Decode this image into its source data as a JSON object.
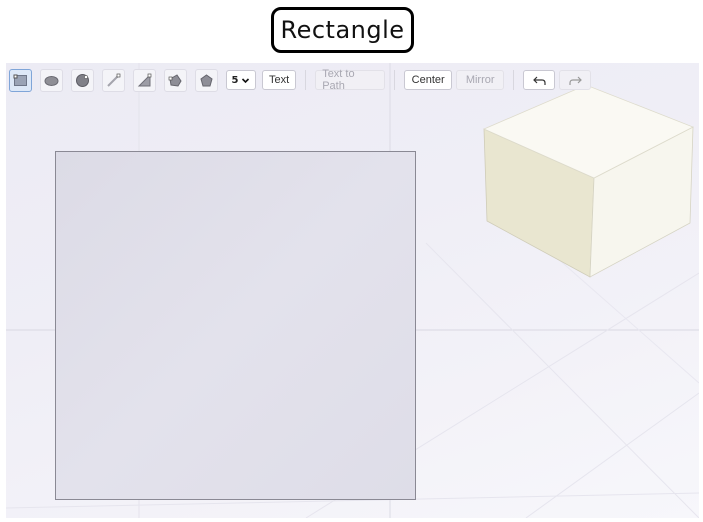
{
  "tool_label": "Rectangle",
  "toolbar": {
    "icons": [
      "rectangle-icon",
      "ellipse-icon",
      "circle-icon",
      "line-icon",
      "polyline-icon",
      "polygon-icon",
      "pentagon-icon"
    ],
    "sides_value": "5",
    "text_label": "Text",
    "text_to_path_label": "Text to Path",
    "center_label": "Center",
    "mirror_label": "Mirror",
    "undo_icon": "undo-icon",
    "redo_icon": "redo-icon"
  },
  "colors": {
    "active_tool": "#dde8f7",
    "cube_face": "#f4f2e4"
  }
}
